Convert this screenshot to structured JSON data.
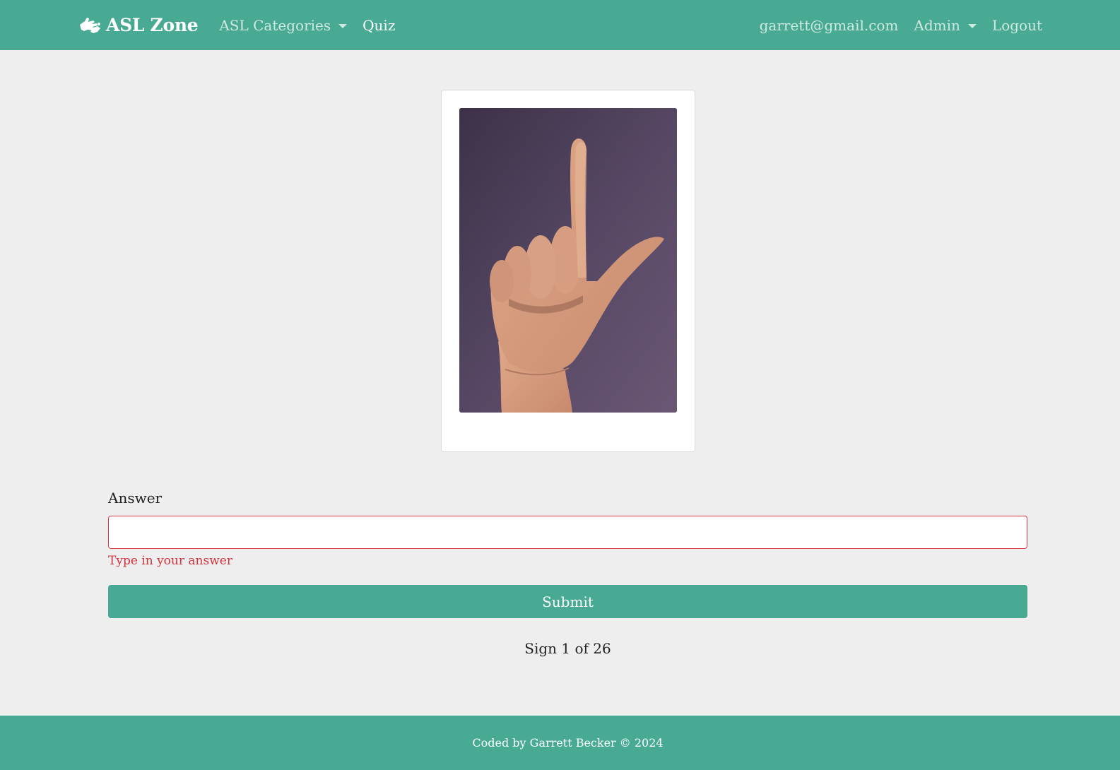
{
  "navbar": {
    "brand": "ASL Zone",
    "brand_icon": "hand-sign-icon",
    "left_items": [
      {
        "label": "ASL Categories",
        "dropdown": true,
        "active": false
      },
      {
        "label": "Quiz",
        "dropdown": false,
        "active": true
      }
    ],
    "right_items": [
      {
        "label": "garrett@gmail.com",
        "dropdown": false
      },
      {
        "label": "Admin",
        "dropdown": true
      },
      {
        "label": "Logout",
        "dropdown": false
      }
    ]
  },
  "quiz": {
    "image_icon": "asl-hand-sign-image",
    "answer_label": "Answer",
    "answer_value": "",
    "validation_message": "Type in your answer",
    "submit_label": "Submit",
    "progress_text": "Sign 1 of 26"
  },
  "footer": {
    "text": "Coded by Garrett Becker © 2024"
  },
  "colors": {
    "brand": "#48aa92",
    "background": "#eeeeee",
    "error": "#d93a48"
  }
}
